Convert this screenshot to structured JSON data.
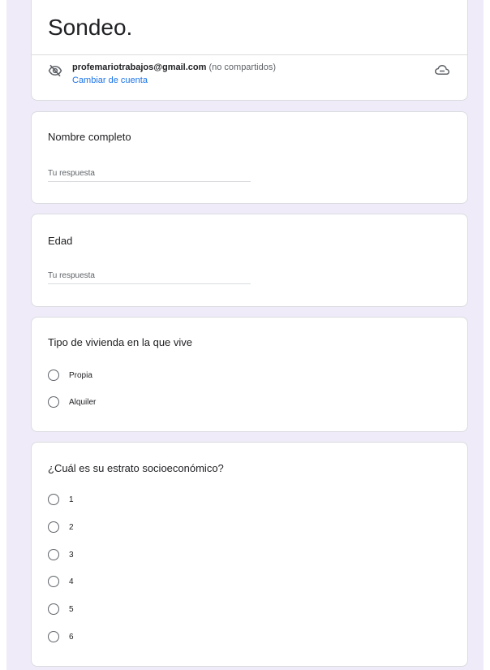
{
  "form": {
    "title": "Sondeo.",
    "account": {
      "email": "profemariotrabajos@gmail.com",
      "note": "(no compartidos)",
      "switch_label": "Cambiar de cuenta"
    }
  },
  "questions": [
    {
      "title": "Nombre completo",
      "type": "text",
      "placeholder": "Tu respuesta"
    },
    {
      "title": "Edad",
      "type": "text",
      "placeholder": "Tu respuesta"
    },
    {
      "title": "Tipo de vivienda en la que vive",
      "type": "radio",
      "options": [
        "Propia",
        "Alquiler"
      ]
    },
    {
      "title": "¿Cuál es su estrato socioeconómico?",
      "type": "radio",
      "options": [
        "1",
        "2",
        "3",
        "4",
        "5",
        "6"
      ]
    }
  ],
  "icons": {
    "privacy": "eye-off-icon",
    "save_state": "cloud-icon"
  },
  "colors": {
    "page_background": "#efebf8",
    "link": "#1a73e8",
    "card_border": "#dadce0"
  }
}
